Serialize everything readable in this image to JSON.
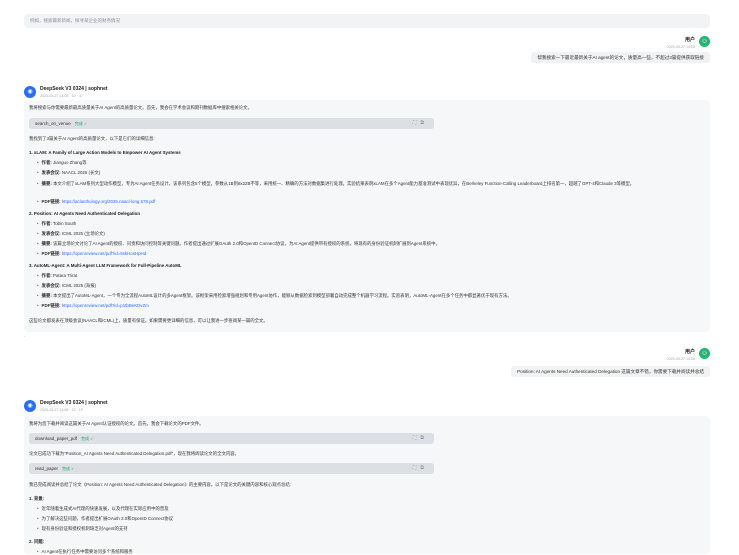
{
  "search_bar": {
    "placeholder": "例如，搜索最新新闻，探寻某企业的财务情况"
  },
  "messages": {
    "user1": {
      "name": "用户",
      "time": "2025-03-27 14:05",
      "text": "帮我搜索一下最近最新关于AI agent的论文，质量高一些，不超过3篇提供获取链接"
    },
    "ai1": {
      "name": "DeepSeek V3 0324 | sophnet",
      "time": "2025-03-27 14:05 · 32 · 47",
      "intro": "我将搜索与你需要最新最高质量关于AI Agent的高质量论文。首先，我会在学术会议和期刊数据库中搜索相关论文。",
      "tool": {
        "name": "search_on_venue",
        "status": "完成 ✓"
      },
      "result_intro": "我找到了3篇关于AI Agent的高质量论文，以下是它们的详细信息:",
      "papers": [
        {
          "num": "1.",
          "title": "xLAM: A Family of Large Action Models to Empower AI Agent Systems",
          "author_label": "作者:",
          "author": "Jianguo Zhang等",
          "venue_label": "发表会议:",
          "venue": "NAACL 2025 (长文)",
          "abstract_label": "摘要:",
          "abstract": "本文介绍了xLAM系列大型动作模型，专为AI Agent任务设计。该系列包含5个模型，参数从1B到8x22B不等，采用统一、精确的方法对数据集进行处理。实验结果表明xLAM在多个Agent能力基准测试中表现优异，在Berkeley Function-Calling Leaderboard上排名第一，超越了GPT-4和Claude 3等模型。",
          "pdf_label": "PDF链接:",
          "pdf": "https://aclanthology.org/2025.naacl-long.578.pdf"
        },
        {
          "num": "2.",
          "title": "Position: AI Agents Need Authenticated Delegation",
          "author_label": "作者:",
          "author": "Tobin South",
          "venue_label": "发表会议:",
          "venue": "ICML 2025 (立场论文)",
          "abstract_label": "摘要:",
          "abstract": "该篇立场论文讨论了AI Agent的授权、问责和访问控制等关键问题。作者提出通过扩展OAuth 2.0和OpenID Connect协议，为AI Agent提供带有授权的系统，将现有的身份验证机制扩展到Agent系统中。",
          "pdf_label": "PDF链接:",
          "pdf": "https://openreview.net/pdf?id=9skHosHpHd"
        },
        {
          "num": "3.",
          "title": "AutoML-Agent: A Multi-Agent LLM Framework for Full-Pipeline AutoML",
          "author_label": "作者:",
          "author": "Patara Trirat",
          "venue_label": "发表会议:",
          "venue": "ICML 2025 (海报)",
          "abstract_label": "摘要:",
          "abstract": "本文提出了AutoML-Agent，一个专为全流程AutoML设计的多Agent框架。该框架采用检索增强规划和专用Agent协作，能够从数据检索到模型部署自动完成整个机器学习流程。实验表明，AutoML-Agent在多个任务中都显著优于现有方法。",
          "pdf_label": "PDF链接:",
          "pdf": "https://openreview.net/pdf?id=p1tbBeKDvZm"
        }
      ],
      "footer": "这些论文都发表在顶级会议(NAACL和ICML)上，质量有保证。如果需要更详细的信息，可以让我进一步查阅某一篇的全文。"
    },
    "user2": {
      "name": "用户",
      "time": "2025-03-27 14:08",
      "text": "Position: AI Agents Need Authenticated Delegation 这篇文章不错，你需要下载并阅读并总结"
    },
    "ai2": {
      "name": "DeepSeek V3 0324 | sophnet",
      "time": "2025-03-27 14:08 · 22 · 19",
      "intro": "我将为您下载并阅读这篇关于AI Agent认证授权的论文。首先，我会下载论文的PDF文件。",
      "tool1": {
        "name": "download_paper_pdf",
        "status": "完成 ✓"
      },
      "mid": "论文已成功下载为\"Position_AI Agents Need Authenticated Delegation.pdf\"，现在我将阅读论文的全文内容。",
      "tool2": {
        "name": "read_paper",
        "status": "完成 ✓"
      },
      "summary_intro": "我已完成阅读并总结了论文《Position: AI Agents Need Authenticated Delegation》的主要内容。以下是论文的关键内容和核心观点总结:",
      "sections": [
        {
          "title": "1. 背景:",
          "bullets": [
            "近年随着生成式AI代理的快速发展，以及代理在实际应用中的普及",
            "为了解决这些问题，作者提出扩展OAuth 2.0和OpenID Connect协议",
            "现有身份验证和授权机制缺乏对Agent的支持"
          ]
        },
        {
          "title": "2. 问题:",
          "bullets": [
            "AI Agent在执行任务中需要访问多个系统和服务"
          ]
        }
      ]
    }
  }
}
